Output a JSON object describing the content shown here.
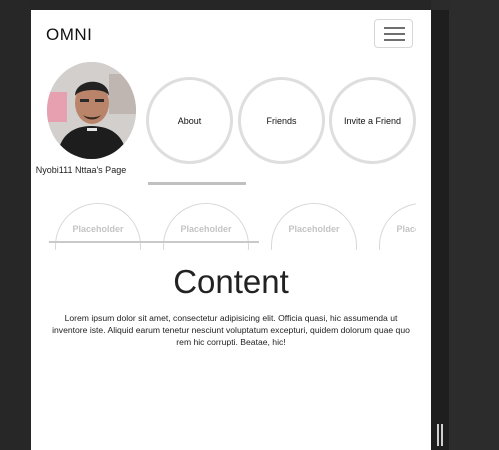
{
  "navbar": {
    "brand": "OMNI",
    "toggle_icon": "hamburger-icon"
  },
  "profile": {
    "caption": "Nyobi111 Nttaa's Page"
  },
  "circle_nav": [
    {
      "label": "About"
    },
    {
      "label": "Friends"
    },
    {
      "label": "Invite a Friend"
    }
  ],
  "placeholders": [
    {
      "label": "Placeholder"
    },
    {
      "label": "Placeholder"
    },
    {
      "label": "Placeholder"
    },
    {
      "label": "Placeholder"
    }
  ],
  "content": {
    "title": "Content",
    "body": "Lorem ipsum dolor sit amet, consectetur adipisicing elit. Officia quasi, hic assumenda ut inventore iste. Aliquid earum tenetur nesciunt voluptatum excepturi, quidem dolorum quae quo rem hic corrupti. Beatae, hic!"
  },
  "colors": {
    "page_background": "#ffffff",
    "app_background": "#2b2b2b",
    "circle_border": "#dedede",
    "placeholder_text": "#c4c4c4"
  }
}
